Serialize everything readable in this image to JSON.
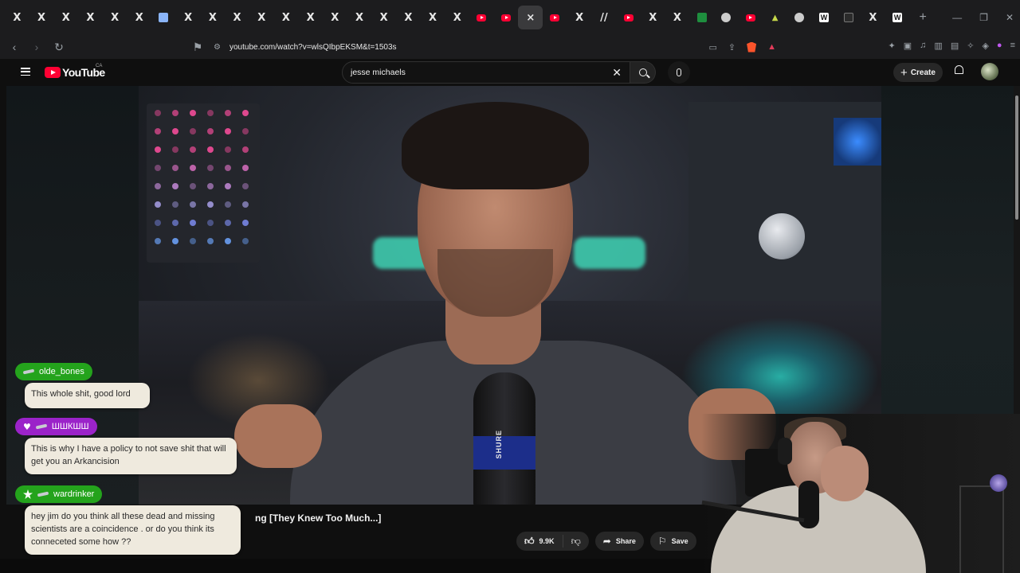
{
  "browser": {
    "tabs": [
      {
        "icon": "x-logo-icon",
        "label": "X"
      },
      {
        "icon": "x-logo-icon",
        "label": "X"
      },
      {
        "icon": "x-logo-icon",
        "label": "X"
      },
      {
        "icon": "x-logo-icon",
        "label": "X"
      },
      {
        "icon": "x-logo-icon",
        "label": "X"
      },
      {
        "icon": "x-logo-icon",
        "label": "X"
      },
      {
        "icon": "calendar-icon",
        "label": ""
      },
      {
        "icon": "x-logo-icon",
        "label": "X"
      },
      {
        "icon": "x-logo-icon",
        "label": "X"
      },
      {
        "icon": "x-logo-icon",
        "label": "X"
      },
      {
        "icon": "x-logo-icon",
        "label": "X"
      },
      {
        "icon": "x-logo-icon",
        "label": "X"
      },
      {
        "icon": "x-logo-icon",
        "label": "X"
      },
      {
        "icon": "x-logo-icon",
        "label": "X"
      },
      {
        "icon": "x-logo-icon",
        "label": "X"
      },
      {
        "icon": "x-logo-icon",
        "label": "X"
      },
      {
        "icon": "x-logo-icon",
        "label": "X"
      },
      {
        "icon": "x-logo-icon",
        "label": "X"
      },
      {
        "icon": "x-logo-icon",
        "label": "X"
      },
      {
        "icon": "youtube-icon",
        "label": ""
      },
      {
        "icon": "youtube-icon",
        "label": ""
      },
      {
        "icon": "close-icon",
        "label": "×",
        "active": true
      },
      {
        "icon": "youtube-icon",
        "label": ""
      },
      {
        "icon": "x-logo-icon",
        "label": "X"
      },
      {
        "icon": "slash-icon",
        "label": "//"
      },
      {
        "icon": "youtube-icon",
        "label": ""
      },
      {
        "icon": "x-logo-icon",
        "label": "X"
      },
      {
        "icon": "x-logo-icon",
        "label": "X"
      },
      {
        "icon": "spreadsheet-icon",
        "label": ""
      },
      {
        "icon": "globe-icon",
        "label": ""
      },
      {
        "icon": "youtube-icon",
        "label": ""
      },
      {
        "icon": "triangle-logo-icon",
        "label": ""
      },
      {
        "icon": "globe-icon",
        "label": ""
      },
      {
        "icon": "w-logo-icon",
        "label": "W"
      },
      {
        "icon": "dark-logo-icon",
        "label": ""
      },
      {
        "icon": "x-logo-icon",
        "label": "X"
      },
      {
        "icon": "w-logo-icon",
        "label": "W"
      }
    ],
    "new_tab_label": "+",
    "url": "youtube.com/watch?v=wlsQIbpEKSM&t=1503s"
  },
  "youtube": {
    "logo_text": "YouTube",
    "country_code": "CA",
    "search_value": "jesse michaels",
    "create_label": "Create",
    "video_title": "ng [They Knew Too Much...]",
    "like_count": "9.9K",
    "share_label": "Share",
    "save_label": "Save",
    "mic_brand": "SHURE"
  },
  "chat": [
    {
      "username": "olde_bones",
      "badge": "sword",
      "color": "#24a31c",
      "message": "This whole shit, good lord"
    },
    {
      "username": "ШШКШШ",
      "badge": "heart",
      "color": "#9b23c9",
      "message": "This is why I have a policy to not save shit that will get you an Arkancision"
    },
    {
      "username": "wardrinker",
      "badge": "star",
      "color": "#24a31c",
      "message": "hey jim do you think all these dead and missing scientists are a coincidence . or do you think its conneceted some how ??"
    }
  ],
  "colors": {
    "youtube_red": "#ff0033",
    "brave_orange": "#fb542b",
    "page_bg": "#0f0f0f"
  }
}
